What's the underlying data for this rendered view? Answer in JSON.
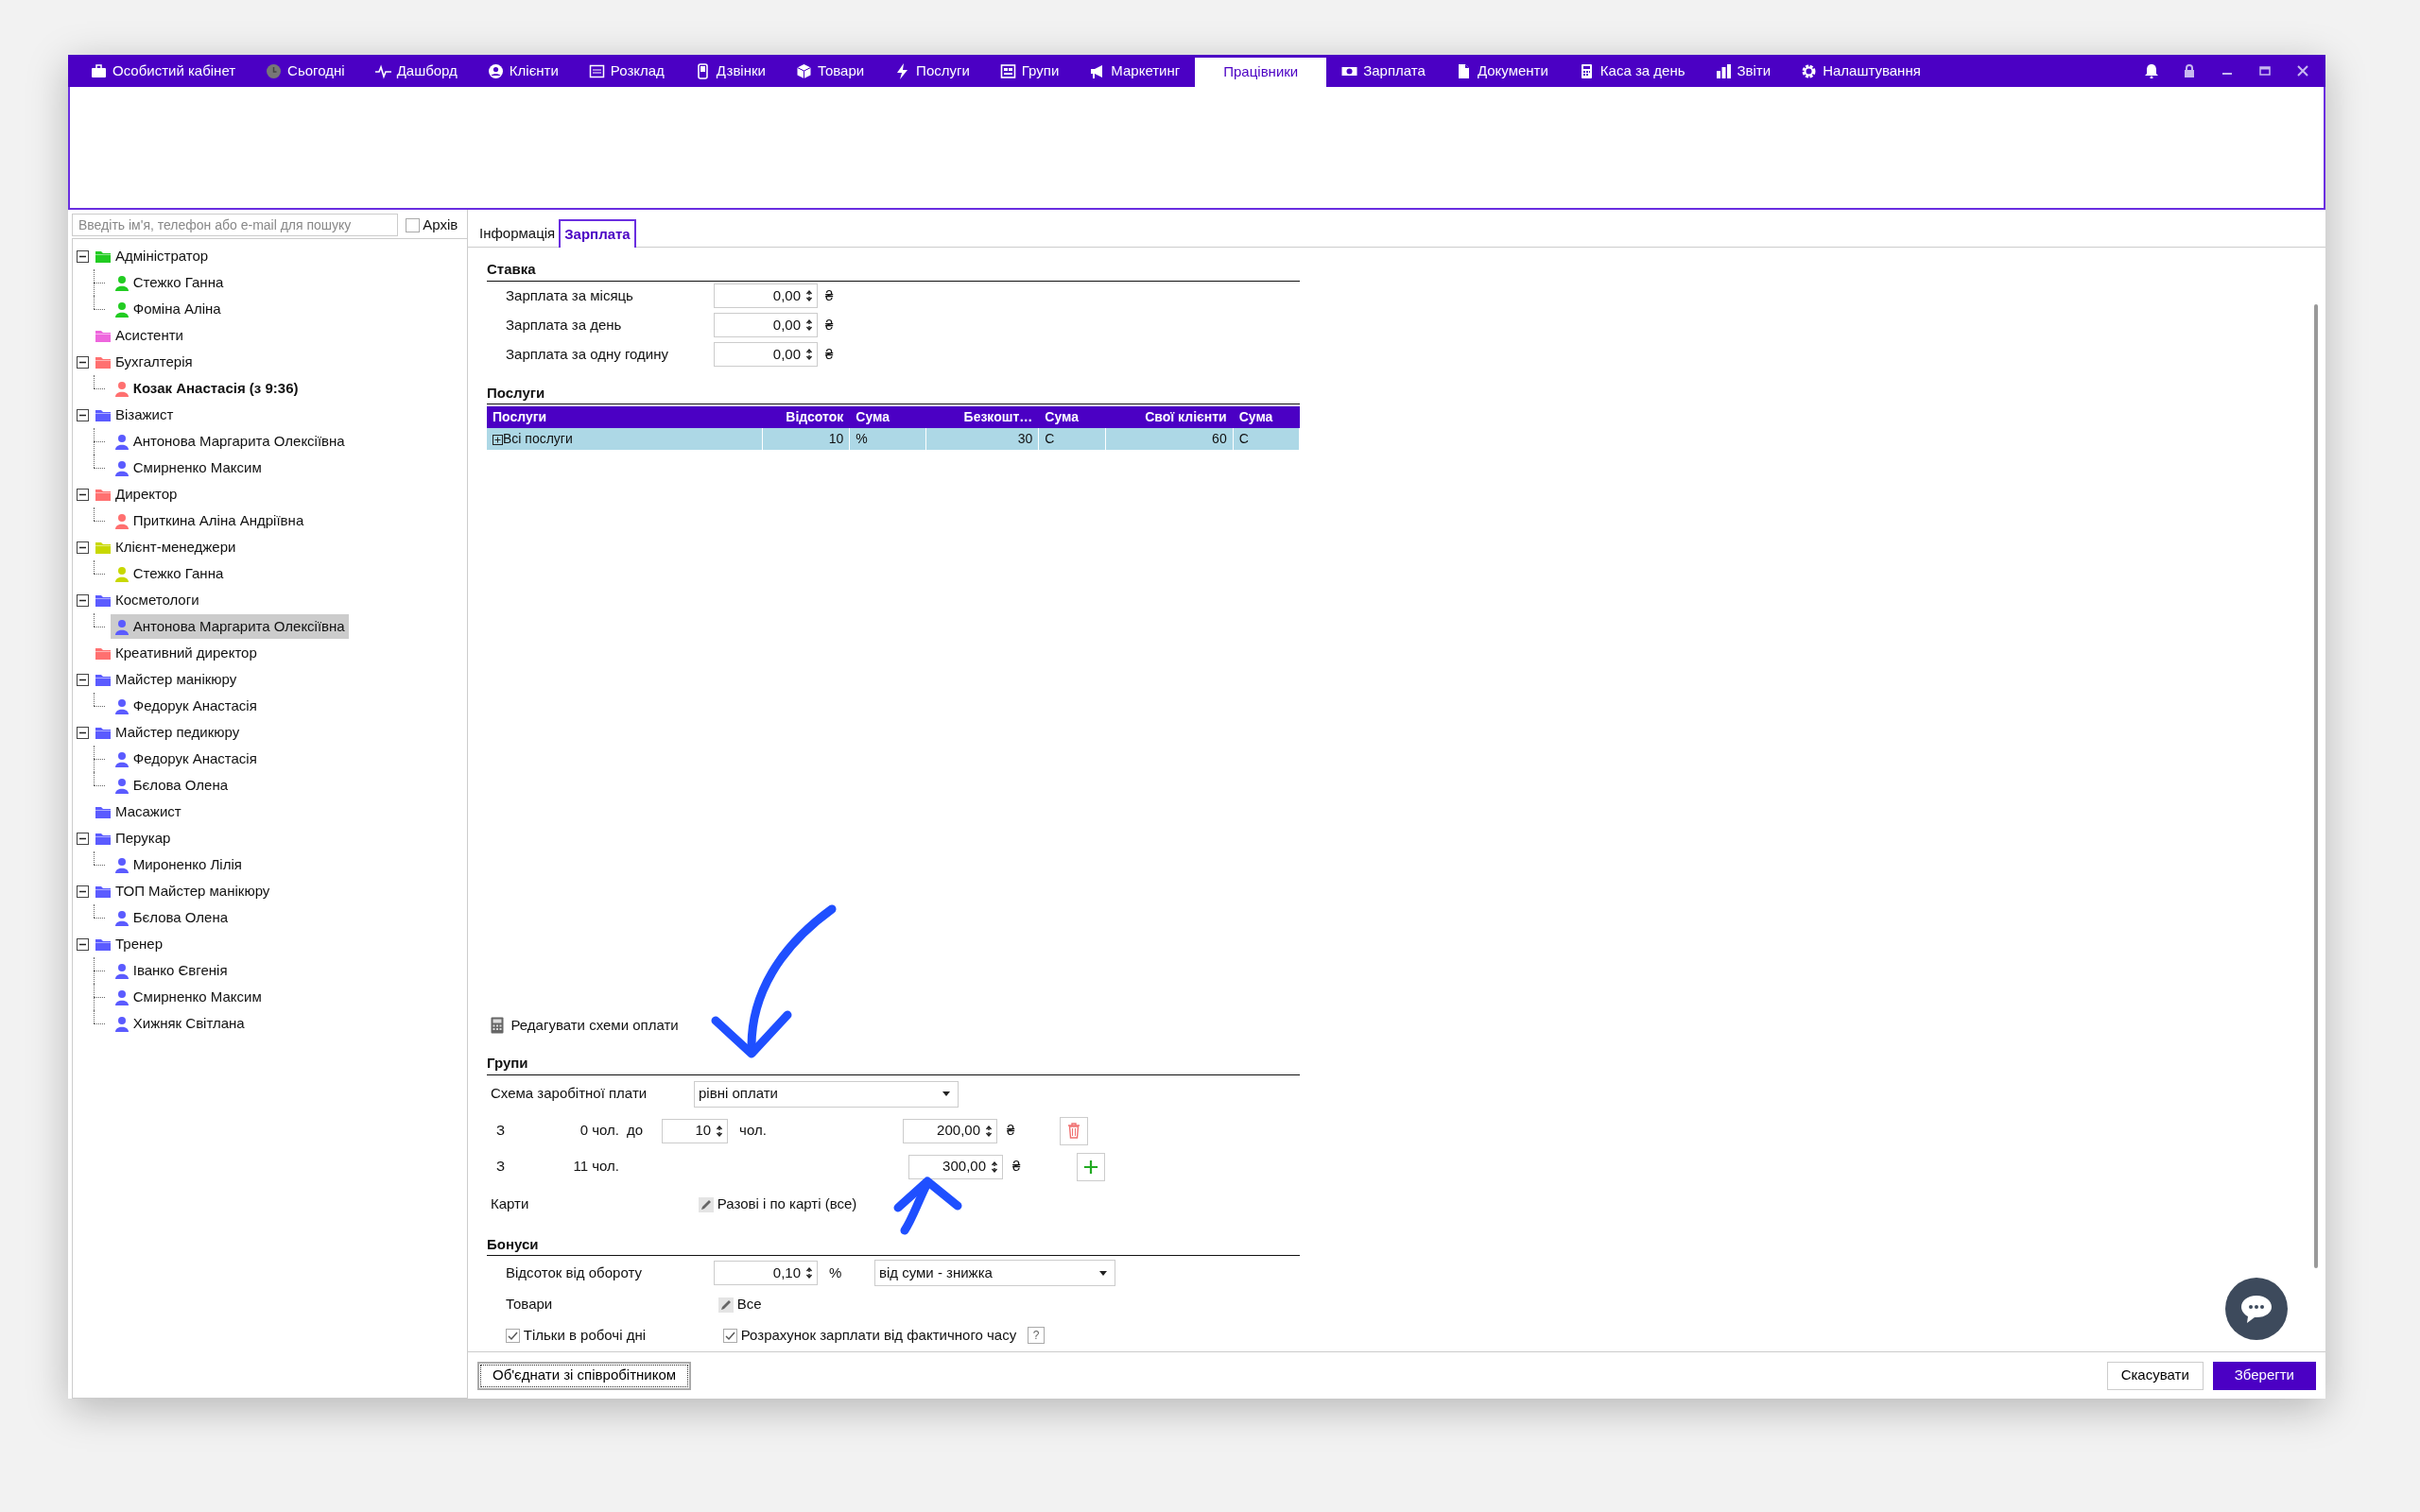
{
  "nav": [
    {
      "label": "Особистий кабінет",
      "selected": false
    },
    {
      "label": "Сьогодні",
      "selected": false
    },
    {
      "label": "Дашборд",
      "selected": false
    },
    {
      "label": "Клієнти",
      "selected": false
    },
    {
      "label": "Розклад",
      "selected": false
    },
    {
      "label": "Дзвінки",
      "selected": false
    },
    {
      "label": "Товари",
      "selected": false
    },
    {
      "label": "Послуги",
      "selected": false
    },
    {
      "label": "Групи",
      "selected": false
    },
    {
      "label": "Маркетинг",
      "selected": false
    },
    {
      "label": "Працівники",
      "selected": true
    },
    {
      "label": "Зарплата",
      "selected": false
    },
    {
      "label": "Документи",
      "selected": false
    },
    {
      "label": "Каса за день",
      "selected": false
    },
    {
      "label": "Звіти",
      "selected": false
    },
    {
      "label": "Налаштування",
      "selected": false
    }
  ],
  "search": {
    "placeholder": "Введіть ім'я, телефон або e-mail для пошуку"
  },
  "archive": {
    "label": "Архів",
    "checked": false
  },
  "tree": [
    {
      "label": "Адміністратор",
      "color": "#22cc22",
      "expanded": true,
      "children": [
        {
          "label": "Стежко Ганна",
          "emphasized": false,
          "selected": false
        },
        {
          "label": "Фоміна Аліна",
          "emphasized": false,
          "selected": false
        }
      ]
    },
    {
      "label": "Асистенти",
      "color": "#ee66dd"
    },
    {
      "label": "Бухгалтерія",
      "color": "#ff7070",
      "expanded": true,
      "children": [
        {
          "label": "Козак Анастасія (з 9:36)",
          "emphasized": true,
          "selected": false
        }
      ]
    },
    {
      "label": "Візажист",
      "color": "#5b5bff",
      "expanded": true,
      "children": [
        {
          "label": "Антонова Маргарита Олексіївна",
          "emphasized": false,
          "selected": false
        },
        {
          "label": "Смирненко Максим",
          "emphasized": false,
          "selected": false
        }
      ]
    },
    {
      "label": "Директор",
      "color": "#ff7070",
      "expanded": true,
      "children": [
        {
          "label": "Приткина Аліна Андріївна",
          "emphasized": false,
          "selected": false
        }
      ]
    },
    {
      "label": "Клієнт-менеджери",
      "color": "#c8d800",
      "expanded": true,
      "children": [
        {
          "label": "Стежко Ганна",
          "emphasized": false,
          "selected": false
        }
      ]
    },
    {
      "label": "Косметологи",
      "color": "#5b5bff",
      "expanded": true,
      "children": [
        {
          "label": "Антонова Маргарита Олексіївна",
          "emphasized": false,
          "selected": true
        }
      ]
    },
    {
      "label": "Креативний директор",
      "color": "#ff7070"
    },
    {
      "label": "Майстер манікюру",
      "color": "#5b5bff",
      "expanded": true,
      "children": [
        {
          "label": "Федорук Анастасія",
          "emphasized": false,
          "selected": false
        }
      ]
    },
    {
      "label": "Майстер педикюру",
      "color": "#5b5bff",
      "expanded": true,
      "children": [
        {
          "label": "Федорук Анастасія",
          "emphasized": false,
          "selected": false
        },
        {
          "label": "Бєлова Олена",
          "emphasized": false,
          "selected": false
        }
      ]
    },
    {
      "label": "Масажист",
      "color": "#5b5bff"
    },
    {
      "label": "Перукар",
      "color": "#5b5bff",
      "expanded": true,
      "children": [
        {
          "label": "Мироненко Лілія",
          "emphasized": false,
          "selected": false
        }
      ]
    },
    {
      "label": "ТОП Майстер манікюру",
      "color": "#5b5bff",
      "expanded": true,
      "children": [
        {
          "label": "Бєлова Олена",
          "emphasized": false,
          "selected": false
        }
      ]
    },
    {
      "label": "Тренер",
      "color": "#5b5bff",
      "expanded": true,
      "children": [
        {
          "label": "Іванко Євгенія",
          "emphasized": false,
          "selected": false
        },
        {
          "label": "Смирненко Максим",
          "emphasized": false,
          "selected": false
        },
        {
          "label": "Хижняк Світлана",
          "emphasized": false,
          "selected": false
        }
      ]
    }
  ],
  "tabs": [
    {
      "label": "Інформація",
      "selected": false
    },
    {
      "label": "Зарплата",
      "selected": true
    }
  ],
  "rate": {
    "title": "Ставка",
    "rows": [
      {
        "label": "Зарплата за місяць",
        "value": "0,00",
        "unit": "₴"
      },
      {
        "label": "Зарплата за день",
        "value": "0,00",
        "unit": "₴"
      },
      {
        "label": "Зарплата за одну годину",
        "value": "0,00",
        "unit": "₴"
      }
    ]
  },
  "services": {
    "title": "Послуги",
    "columns": [
      "Послуги",
      "Відсоток",
      "Сума",
      "Безкошт…",
      "Сума",
      "Свої клієнти",
      "Сума"
    ],
    "rows": [
      {
        "cells": [
          "Всі послуги",
          "10",
          "%",
          "30",
          "С",
          "60",
          "С"
        ],
        "selected": true
      }
    ]
  },
  "edit_schemes": "Редагувати схеми оплати",
  "groups": {
    "title": "Групи",
    "scheme_label": "Схема заробітної плати",
    "scheme_value": "рівні оплати",
    "tiers": [
      {
        "prefix": "З",
        "from": "0 чол.",
        "to_label": "до",
        "to_value": "10",
        "to_unit": "чол.",
        "amount": "200,00",
        "currency": "₴",
        "kind": "delete"
      },
      {
        "prefix": "З",
        "from": "11 чол.",
        "amount": "300,00",
        "currency": "₴",
        "kind": "add"
      }
    ],
    "cards_label": "Карти",
    "cards_value": "Разові і по карті (все)"
  },
  "bonuses": {
    "title": "Бонуси",
    "turnover_label": "Відсоток від обороту",
    "turnover_value": "0,10",
    "turnover_unit": "%",
    "mode": "від суми - знижка",
    "goods_label": "Товари",
    "goods_value": "Все",
    "checks": [
      {
        "label": "Тільки в робочі дні",
        "checked": true
      },
      {
        "label": "Розрахунок зарплати від фактичного часу",
        "checked": true
      }
    ],
    "help": "?"
  },
  "footer": {
    "merge": "Об'єднати зі співробітником",
    "cancel": "Скасувати",
    "save": "Зберегти"
  }
}
